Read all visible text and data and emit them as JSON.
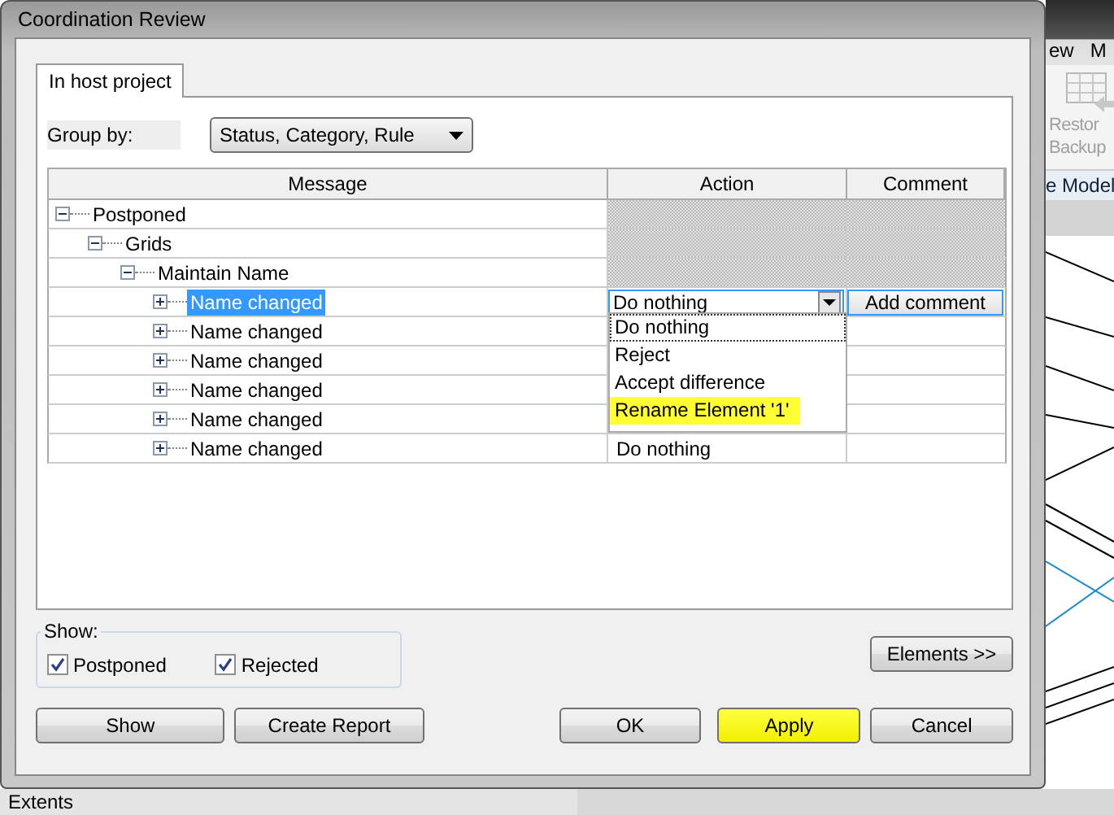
{
  "window": {
    "title": "Coordination Review"
  },
  "tabs": [
    {
      "label": "In host project",
      "selected": true
    }
  ],
  "group_by": {
    "label": "Group by:",
    "value": "Status, Category, Rule"
  },
  "table": {
    "columns": [
      "Message",
      "Action",
      "Comment"
    ],
    "tree": [
      {
        "label": "Postponed",
        "expanded": true,
        "children": [
          {
            "label": "Grids",
            "expanded": true,
            "children": [
              {
                "label": "Maintain Name",
                "expanded": true,
                "children": [
                  {
                    "label": "Name changed",
                    "expanded": false,
                    "selected": true,
                    "action": "Do nothing",
                    "comment": "Add comment"
                  },
                  {
                    "label": "Name changed",
                    "expanded": false,
                    "selected": false
                  },
                  {
                    "label": "Name changed",
                    "expanded": false,
                    "selected": false
                  },
                  {
                    "label": "Name changed",
                    "expanded": false,
                    "selected": false
                  },
                  {
                    "label": "Name changed",
                    "expanded": false,
                    "selected": false
                  },
                  {
                    "label": "Name changed",
                    "expanded": false,
                    "selected": false,
                    "action": "Do nothing"
                  }
                ]
              }
            ]
          }
        ]
      }
    ]
  },
  "action_dropdown": {
    "options": [
      {
        "label": "Do nothing",
        "selected": true,
        "highlighted": false
      },
      {
        "label": "Reject",
        "selected": false,
        "highlighted": false
      },
      {
        "label": "Accept difference",
        "selected": false,
        "highlighted": false
      },
      {
        "label": "Rename Element '1'",
        "selected": false,
        "highlighted": true
      }
    ]
  },
  "show": {
    "label": "Show:",
    "checkboxes": [
      {
        "label": "Postponed",
        "checked": true
      },
      {
        "label": "Rejected",
        "checked": true
      }
    ]
  },
  "elements_button": {
    "label": "Elements >>"
  },
  "buttons": [
    {
      "label": "Show",
      "highlighted": false
    },
    {
      "label": "Create Report",
      "highlighted": false
    },
    {
      "label": "OK",
      "highlighted": false
    },
    {
      "label": "Apply",
      "highlighted": true
    },
    {
      "label": "Cancel",
      "highlighted": false
    }
  ],
  "background_app": {
    "ribbon_tabs": [
      "ew",
      "M"
    ],
    "ribbon_button": [
      "Restor",
      "Backup"
    ],
    "panel_title": "e Model",
    "bottom_panel_title": "Extents"
  }
}
